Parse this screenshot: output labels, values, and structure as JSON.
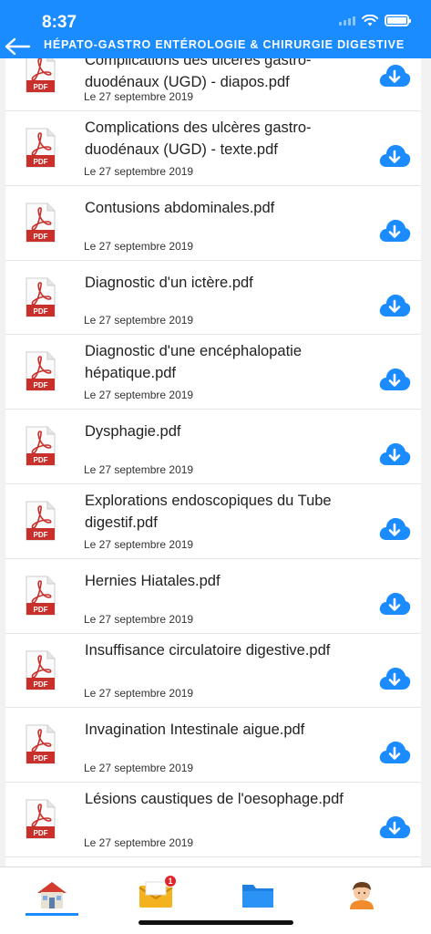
{
  "status": {
    "time": "8:37"
  },
  "header": {
    "title": "HÉPATO-GASTRO ENTÉROLOGIE & CHIRURGIE DIGESTIVE"
  },
  "files": [
    {
      "title": "Complications des ulcères gastro-duodénaux (UGD) - diapos.pdf",
      "date": "Le 27 septembre 2019"
    },
    {
      "title": "Complications des ulcères gastro-duodénaux (UGD) - texte.pdf",
      "date": "Le 27 septembre 2019"
    },
    {
      "title": "Contusions abdominales.pdf",
      "date": "Le 27 septembre 2019"
    },
    {
      "title": "Diagnostic d'un ictère.pdf",
      "date": "Le 27 septembre 2019"
    },
    {
      "title": "Diagnostic d'une encéphalopatie hépatique.pdf",
      "date": "Le 27 septembre 2019"
    },
    {
      "title": "Dysphagie.pdf",
      "date": "Le 27 septembre 2019"
    },
    {
      "title": "Explorations endoscopiques du Tube digestif.pdf",
      "date": "Le 27 septembre 2019"
    },
    {
      "title": "Hernies Hiatales.pdf",
      "date": "Le 27 septembre 2019"
    },
    {
      "title": "Insuffisance circulatoire digestive.pdf",
      "date": "Le 27 septembre 2019"
    },
    {
      "title": "Invagination Intestinale aigue.pdf",
      "date": "Le 27 septembre 2019"
    },
    {
      "title": "Lésions caustiques de l'oesophage.pdf",
      "date": "Le 27 septembre 2019"
    }
  ],
  "pdf_icon_label": "PDF",
  "tabbar": {
    "tabs": [
      {
        "name": "home",
        "icon": "home-icon"
      },
      {
        "name": "messages",
        "icon": "mail-icon",
        "badge": "1"
      },
      {
        "name": "documents",
        "icon": "folder-icon"
      },
      {
        "name": "profile",
        "icon": "avatar-icon"
      }
    ]
  },
  "colors": {
    "accent": "#1a8cff",
    "pdf_red": "#c9302c",
    "badge": "#e0232b"
  }
}
